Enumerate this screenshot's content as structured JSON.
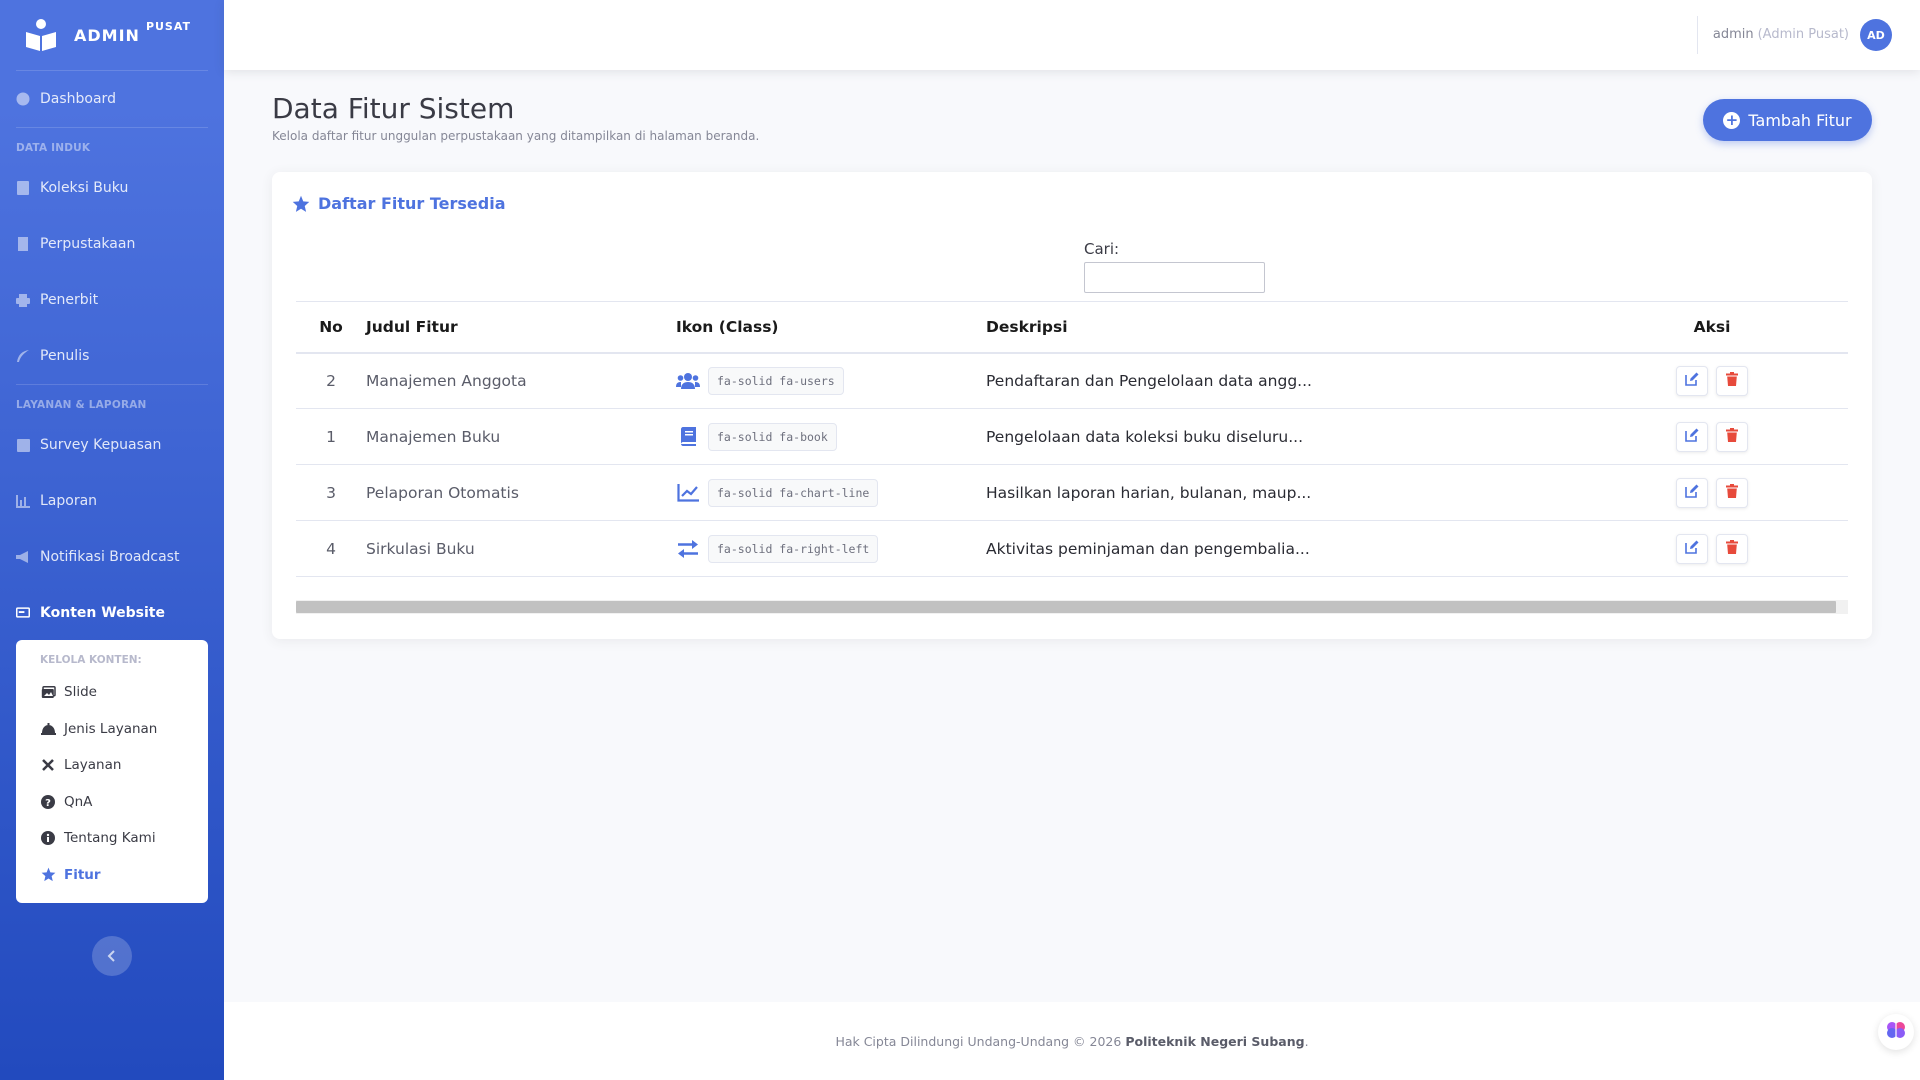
{
  "brand": {
    "title": "ADMIN",
    "sup": "PUSAT"
  },
  "sidebar": {
    "dashboard": "Dashboard",
    "heading_data": "DATA INDUK",
    "koleksi": "Koleksi Buku",
    "perpustakaan": "Perpustakaan",
    "penerbit": "Penerbit",
    "penulis": "Penulis",
    "heading_layanan": "LAYANAN & LAPORAN",
    "survey": "Survey Kepuasan",
    "laporan": "Laporan",
    "notifikasi": "Notifikasi Broadcast",
    "konten": "Konten Website",
    "submenu": {
      "heading": "KELOLA KONTEN:",
      "slide": "Slide",
      "jenis": "Jenis Layanan",
      "layanan": "Layanan",
      "qna": "QnA",
      "tentang": "Tentang Kami",
      "fitur": "Fitur"
    }
  },
  "topbar": {
    "user_name": "admin",
    "user_role": "(Admin Pusat)",
    "avatar": "AD"
  },
  "page": {
    "title": "Data Fitur Sistem",
    "subtitle": "Kelola daftar fitur unggulan perpustakaan yang ditampilkan di halaman beranda.",
    "add_button": "Tambah Fitur"
  },
  "card": {
    "title": "Daftar Fitur Tersedia",
    "search_label": "Cari:",
    "search_value": "",
    "columns": {
      "no": "No",
      "judul": "Judul Fitur",
      "ikon": "Ikon (Class)",
      "desc": "Deskripsi",
      "aksi": "Aksi"
    },
    "rows": [
      {
        "no": "2",
        "judul": "Manajemen Anggota",
        "icon_name": "users-icon",
        "ikon": "fa-solid fa-users",
        "desc": "Pendaftaran dan Pengelolaan data angg..."
      },
      {
        "no": "1",
        "judul": "Manajemen Buku",
        "icon_name": "book-icon",
        "ikon": "fa-solid fa-book",
        "desc": "Pengelolaan data koleksi buku diseluru..."
      },
      {
        "no": "3",
        "judul": "Pelaporan Otomatis",
        "icon_name": "chart-line-icon",
        "ikon": "fa-solid fa-chart-line",
        "desc": "Hasilkan laporan harian, bulanan, maup..."
      },
      {
        "no": "4",
        "judul": "Sirkulasi Buku",
        "icon_name": "right-left-icon",
        "ikon": "fa-solid fa-right-left",
        "desc": "Aktivitas peminjaman dan pengembalia..."
      }
    ]
  },
  "footer": {
    "text": "Hak Cipta Dilindungi Undang-Undang © 2026",
    "org": "Politeknik Negeri Subang",
    "end": "."
  },
  "colors": {
    "primary": "#4e73df",
    "danger": "#e74a3b"
  }
}
